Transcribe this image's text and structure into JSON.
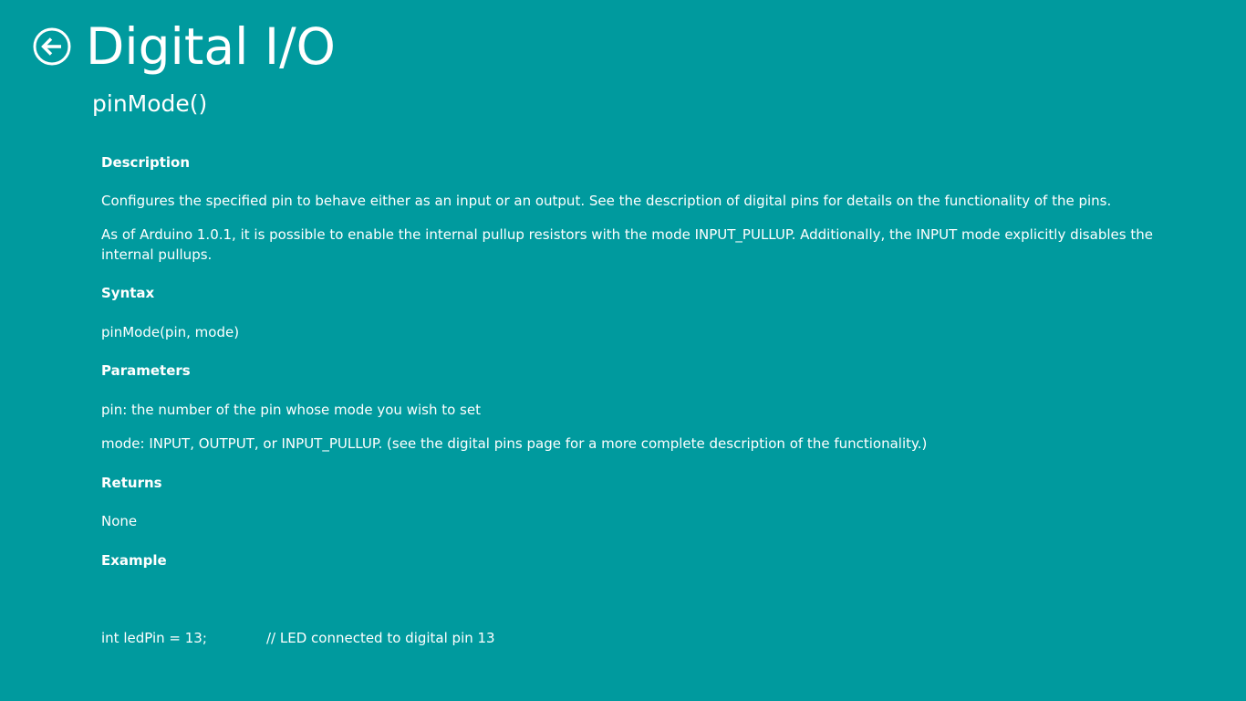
{
  "header": {
    "title": "Digital I/O",
    "subtitle": "pinMode()"
  },
  "sections": {
    "description_heading": "Description",
    "description_p1": "Configures the specified pin to behave either as an input or an output. See the description of digital pins for details on the functionality of the pins.",
    "description_p2": "As of Arduino 1.0.1, it is possible to enable the internal pullup resistors with the mode INPUT_PULLUP. Additionally, the INPUT mode explicitly disables the internal pullups.",
    "syntax_heading": "Syntax",
    "syntax_text": "pinMode(pin, mode)",
    "parameters_heading": "Parameters",
    "param_pin": "pin: the number of the pin whose mode you wish to set",
    "param_mode": "mode: INPUT, OUTPUT, or INPUT_PULLUP. (see the digital pins page for a more complete description of the functionality.)",
    "returns_heading": "Returns",
    "returns_text": "None",
    "example_heading": "Example"
  },
  "example": {
    "code_line_1": "int ledPin = 13;",
    "code_comment_1": "// LED connected to digital pin 13"
  },
  "colors": {
    "background": "#009a9e",
    "text": "#ffffff"
  },
  "icons": {
    "back": "back-arrow-circle-icon"
  }
}
